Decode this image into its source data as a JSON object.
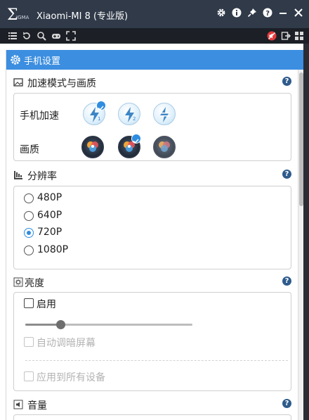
{
  "window": {
    "title": "Xiaomi-MI 8 (专业版)",
    "logo_text": "Σigma"
  },
  "panel": {
    "title": "手机设置"
  },
  "sections": {
    "speed_quality": {
      "title": "加速模式与画质",
      "help": "?",
      "speed_label": "手机加速",
      "quality_label": "画质",
      "speed_options": [
        "1",
        "2",
        "3"
      ],
      "speed_selected": 0,
      "quality_selected": 1
    },
    "resolution": {
      "title": "分辨率",
      "help": "?",
      "options": [
        "480P",
        "640P",
        "720P",
        "1080P"
      ],
      "selected": "720P"
    },
    "brightness": {
      "title": "亮度",
      "help": "?",
      "enable_label": "启用",
      "enabled": false,
      "slider_value": 0.21,
      "auto_dim_label": "自动调暗屏幕",
      "apply_all_label": "应用到所有设备"
    },
    "volume": {
      "title": "音量",
      "help": "?"
    }
  },
  "colors": {
    "titlebar": "#303a49",
    "accent": "#3c8ee0",
    "help_badge": "#2e5b8c"
  }
}
